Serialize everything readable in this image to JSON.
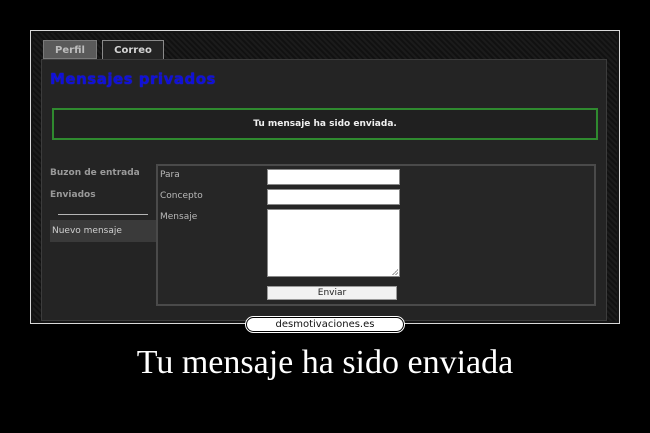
{
  "tabs": [
    {
      "label": "Perfil"
    },
    {
      "label": "Correo"
    }
  ],
  "page": {
    "title": "Mensajes privados",
    "notice": "Tu mensaje ha sido enviada."
  },
  "sidebar": {
    "items": [
      {
        "label": "Buzon de entrada"
      },
      {
        "label": "Enviados"
      },
      {
        "label": "Nuevo mensaje"
      }
    ]
  },
  "form": {
    "labels": {
      "para": "Para",
      "concepto": "Concepto",
      "mensaje": "Mensaje"
    },
    "values": {
      "para": "",
      "concepto": "",
      "mensaje": ""
    },
    "submit_label": "Enviar"
  },
  "poster": {
    "logo": "desmotivaciones.es",
    "caption": "Tu mensaje ha sido enviada"
  },
  "colors": {
    "title": "#1010d8",
    "notice_border": "#2f8a2f",
    "background": "#000000"
  }
}
